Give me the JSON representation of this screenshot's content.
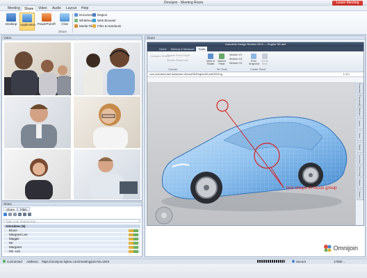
{
  "window": {
    "title": "Omnijoin - Meeting Room",
    "leave_label": "Leave Meeting"
  },
  "ribbon_tabs": [
    "Meeting",
    "Share",
    "Video",
    "Audio",
    "Layout",
    "Help"
  ],
  "ribbon": {
    "buttons": [
      "Desktop",
      "Application",
      "PowerPoint®",
      "Chat"
    ],
    "small_items": [
      "Document",
      "Whiteboard",
      "Media File",
      "Region",
      "Web Browser",
      "Files & Handouts"
    ],
    "group_label": "Share"
  },
  "video": {
    "header": "Video"
  },
  "share": {
    "header": "Share",
    "inner_title": "Autodesk Design Review 2013 — Engine 3D.dwf",
    "inner_tabs": [
      "Home",
      "Markup & Measure",
      "Tools"
    ],
    "inner_ribbon": {
      "canvas_items": [
        "Compare Sheets",
        "Screen Shoot Right",
        "Screen Shoot Left"
      ],
      "canvas_label": "Canvas",
      "tools_buttons": [
        "Move & Rotate",
        "Section Plane",
        "Section XY"
      ],
      "section_items": [
        "Section XY",
        "Section XZ",
        "Section YZ"
      ],
      "tools_label": "3D Tools",
      "snapshot_buttons": [
        "From Snapshot",
        "Create Shell"
      ],
      "snapshot_label": "Create Sheet"
    },
    "path": "com.autodesk.dwf.dwfviewer.v5/cad/3D/Engine3D.dwf/3D/Eng",
    "page_indicator": "1 of 1",
    "side_tabs": [
      "Properties",
      "Thumbnails",
      "Markups",
      "Layers",
      "Views",
      "Model",
      "List View",
      "Grid View",
      "Sheets",
      "Search"
    ],
    "annotation": "test shape in focus group",
    "logo": "Omnijoin"
  },
  "chat": {
    "tabs": [
      "Share",
      "Files"
    ],
    "input_placeholder": "Type your shared text",
    "participants_header": "Attendees (5)",
    "participants": [
      "Bruce",
      "Margaret Lee",
      "Maggie",
      "Mr.",
      "Margaret",
      "Ms. Lee"
    ]
  },
  "status": {
    "connected": "Connected",
    "address_label": "Address:",
    "address": "https://omnijoin.fujitsu.com/meeting/join?id=1823",
    "secure": "Secure",
    "bandwidth": "17880 ..."
  },
  "colors": {
    "accent": "#d81f1f",
    "ribbon_active": "#ffd46b",
    "panel_border": "#9fb0c7"
  }
}
